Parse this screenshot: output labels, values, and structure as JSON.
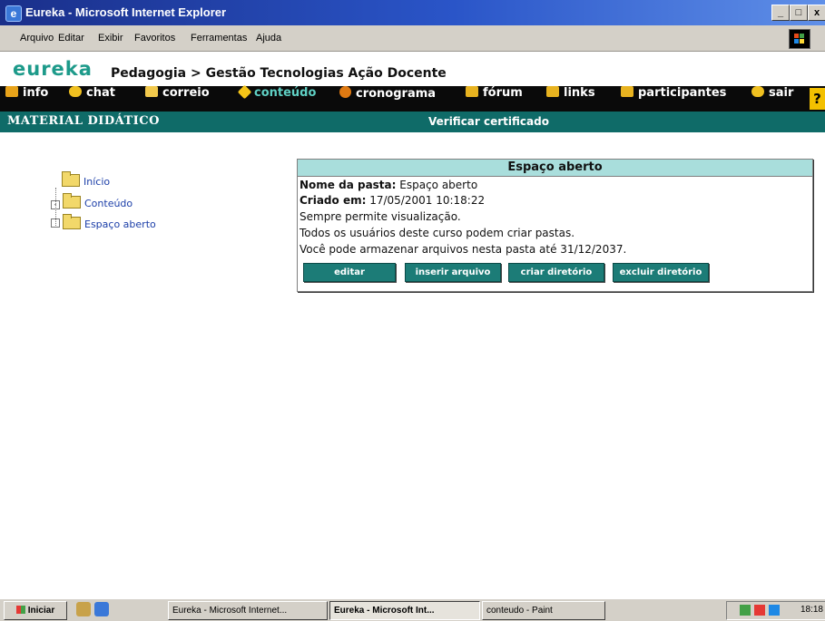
{
  "window": {
    "title": "Eureka - Microsoft Internet Explorer",
    "controls": [
      "_",
      "□",
      "x"
    ]
  },
  "menu": [
    "Arquivo",
    "Editar",
    "Exibir",
    "Favoritos",
    "Ferramentas",
    "Ajuda"
  ],
  "header": {
    "logo": "eureka",
    "breadcrumb": "Pedagogia > Gestão Tecnologias Ação Docente"
  },
  "nav": [
    {
      "label": "info",
      "icon": "info-icon",
      "color": "#e8a31a"
    },
    {
      "label": "chat",
      "icon": "chat-icon",
      "color": "#f0c020"
    },
    {
      "label": "correio",
      "icon": "mail-icon",
      "color": "#f2c94c"
    },
    {
      "label": "conteúdo",
      "icon": "content-icon",
      "color": "#f5c518",
      "active": true
    },
    {
      "label": "cronograma",
      "icon": "schedule-icon",
      "color": "#e07a12"
    },
    {
      "label": "fórum",
      "icon": "forum-icon",
      "color": "#e8b320"
    },
    {
      "label": "links",
      "icon": "links-icon",
      "color": "#e8b320"
    },
    {
      "label": "participantes",
      "icon": "participants-icon",
      "color": "#e8b320"
    },
    {
      "label": "sair",
      "icon": "exit-icon",
      "color": "#f0c020"
    }
  ],
  "help": "?",
  "section": {
    "title": "MATERIAL DIDÁTICO",
    "link": "Verificar certificado"
  },
  "tree": [
    {
      "label": "Início",
      "expander": ""
    },
    {
      "label": "Conteúdo",
      "expander": "-"
    },
    {
      "label": "Espaço aberto",
      "expander": ""
    }
  ],
  "info": {
    "heading": "Espaço aberto",
    "name_label": "Nome da pasta:",
    "name_value": "Espaço aberto",
    "created_label": "Criado em:",
    "created_value": "17/05/2001 10:18:22",
    "line1": "Sempre permite visualização.",
    "line2": "Todos os usuários deste curso podem criar pastas.",
    "line3": "Você pode armazenar arquivos nesta pasta até 31/12/2037."
  },
  "buttons": {
    "edit": "editar",
    "insert": "inserir arquivo",
    "create": "criar diretório",
    "delete": "excluir diretório"
  },
  "taskbar": {
    "start": "Iniciar",
    "tasks": [
      "Eureka - Microsoft Internet...",
      "Eureka - Microsoft Int...",
      "conteudo - Paint"
    ],
    "clock": "18:18"
  }
}
